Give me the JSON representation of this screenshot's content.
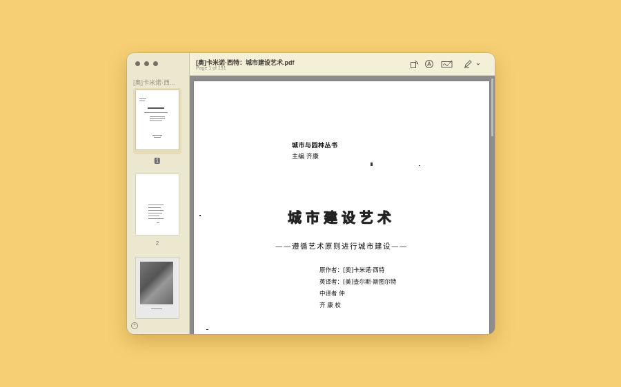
{
  "sidebar": {
    "title": "[奥]卡米诺·西...",
    "pages": [
      {
        "number": "1",
        "selected": true
      },
      {
        "number": "2",
        "selected": false
      }
    ]
  },
  "toolbar": {
    "doc_title": "[奥]卡米诺·西特：城市建设艺术.pdf",
    "page_count": "Page 1 of 151",
    "icons": [
      "rotate-icon",
      "markup-icon",
      "signature-icon",
      "highlight-pen-icon",
      "chevron-down-icon"
    ]
  },
  "page": {
    "series": "城市与园林丛书",
    "editors": "主编    齐康",
    "title": "城市建设艺术",
    "subtitle": "——遵循艺术原则进行城市建设——",
    "credits": [
      "原作者：[奥]卡米诺·西特",
      "英译者：[美]查尔斯·斯图尔特",
      "中译者    仲",
      "齐  康  校"
    ]
  }
}
